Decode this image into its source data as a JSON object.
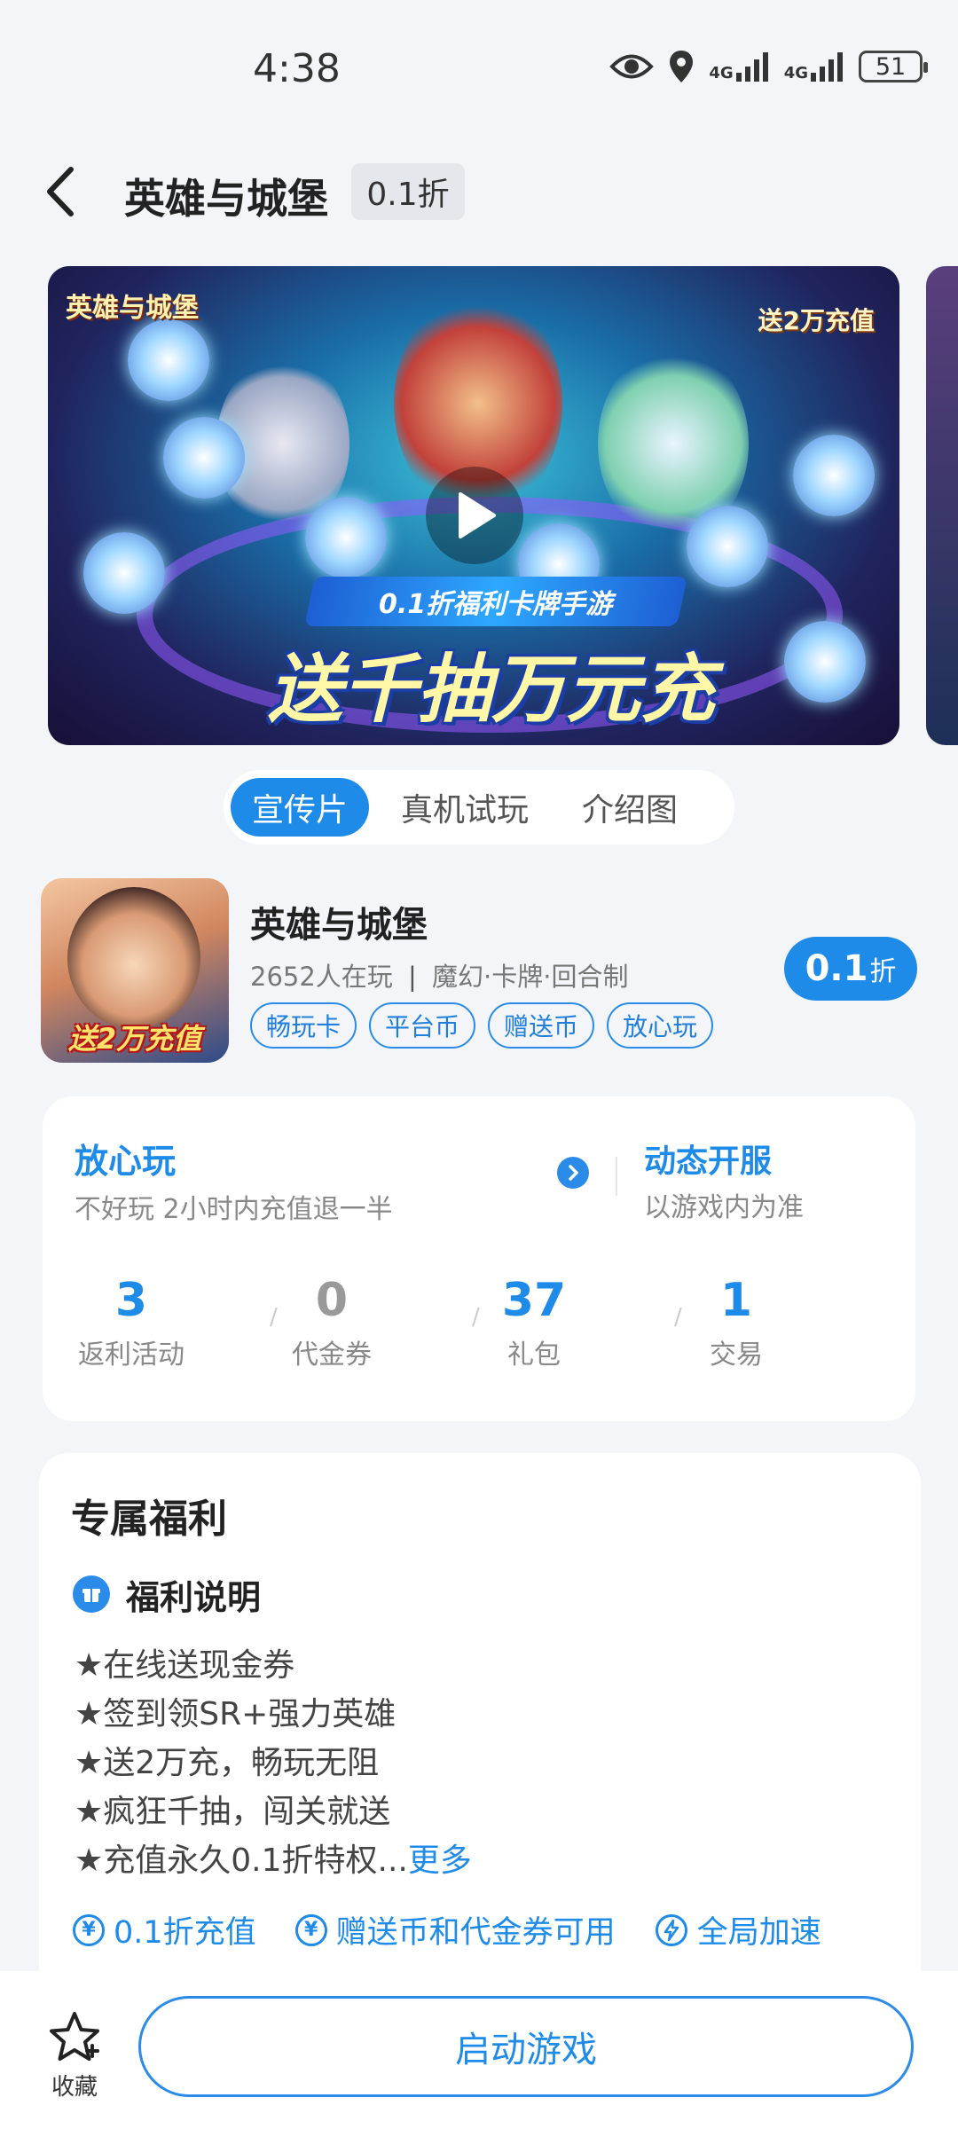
{
  "status_bar": {
    "time": "4:38",
    "network_1": "4G",
    "network_2": "4G",
    "battery": "51",
    "icons": [
      "eye-icon",
      "location-icon",
      "signal-icon",
      "signal-icon",
      "battery-icon"
    ]
  },
  "header": {
    "title": "英雄与城堡",
    "discount": "0.1折"
  },
  "banner": {
    "logo_text": "英雄与城堡",
    "gift_badge": "送2万充值",
    "subtitle": "0.1折福利卡牌手游",
    "slogan": "送千抽万元充"
  },
  "media_tabs": [
    {
      "label": "宣传片",
      "active": true
    },
    {
      "label": "真机试玩",
      "active": false
    },
    {
      "label": "介绍图",
      "active": false
    }
  ],
  "game": {
    "name": "英雄与城堡",
    "players": "2652人在玩",
    "separator": "|",
    "genres": "魔幻·卡牌·回合制",
    "icon_caption": "送2万充值",
    "tags": [
      "畅玩卡",
      "平台币",
      "赠送币",
      "放心玩"
    ],
    "discount_value": "0.1",
    "discount_unit": "折"
  },
  "assurance": {
    "title": "放心玩",
    "subtitle": "不好玩 2小时内充值退一半",
    "server_title": "动态开服",
    "server_subtitle": "以游戏内为准"
  },
  "stats": [
    {
      "value": "3",
      "label": "返利活动"
    },
    {
      "value": "0",
      "label": "代金券"
    },
    {
      "value": "37",
      "label": "礼包"
    },
    {
      "value": "1",
      "label": "交易"
    }
  ],
  "benefits": {
    "section_title": "专属福利",
    "heading": "福利说明",
    "items": [
      "★在线送现金券",
      "★签到领SR+强力英雄",
      "★送2万充，畅玩无阻",
      "★疯狂千抽，闯关就送",
      "★充值永久0.1折特权..."
    ],
    "more": "更多",
    "features": [
      "0.1折充值",
      "赠送币和代金券可用",
      "全局加速"
    ]
  },
  "bottom": {
    "favorite_label": "收藏",
    "start_button": "启动游戏"
  },
  "colors": {
    "accent": "#1e8be8",
    "background": "#f3f5f8"
  }
}
